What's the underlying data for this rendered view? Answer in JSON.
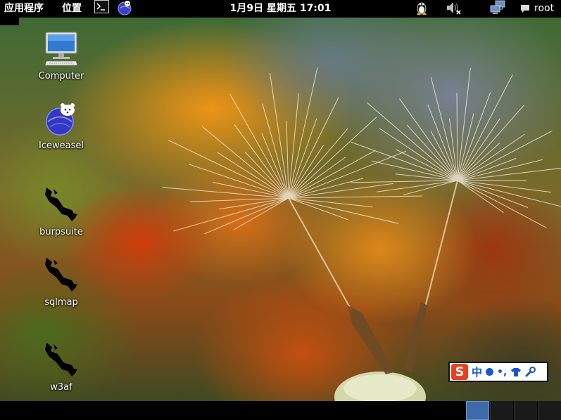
{
  "top_panel": {
    "applications_label": "应用程序",
    "places_label": "位置",
    "terminal_icon": "terminal-icon",
    "browser_icon": "iceweasel-icon",
    "clock": "1月9日 星期五 17:01",
    "penguin_icon": "tux-icon",
    "volume_icon": "volume-muted-icon",
    "network_icon": "network-icon",
    "chat_icon": "chat-icon",
    "user_name": "root"
  },
  "desktop": {
    "icons": [
      {
        "label": "Computer",
        "icon": "computer-icon"
      },
      {
        "label": "Iceweasel",
        "icon": "iceweasel-icon"
      },
      {
        "label": "burpsuite",
        "icon": "kali-dragon-icon"
      },
      {
        "label": "sqlmap",
        "icon": "kali-dragon-icon"
      },
      {
        "label": "w3af",
        "icon": "kali-dragon-icon"
      }
    ]
  },
  "ime_toolbar": {
    "logo": "S",
    "mode": "中",
    "punct": "•,",
    "items": [
      "sogou-logo-icon",
      "chinese-mode-indicator",
      "fullwidth-icon",
      "punctuation-icon",
      "skin-shirt-icon",
      "settings-wrench-icon"
    ]
  },
  "bottom_panel": {
    "workspaces": [
      {
        "name": "workspace-1",
        "active": true
      },
      {
        "name": "workspace-2",
        "active": false
      },
      {
        "name": "workspace-3",
        "active": false
      },
      {
        "name": "workspace-4",
        "active": false
      }
    ]
  },
  "colors": {
    "panel": "#000000",
    "active_workspace": "#3d6aa8",
    "ime_accent": "#1a56c4",
    "ime_logo": "#e8401c"
  }
}
